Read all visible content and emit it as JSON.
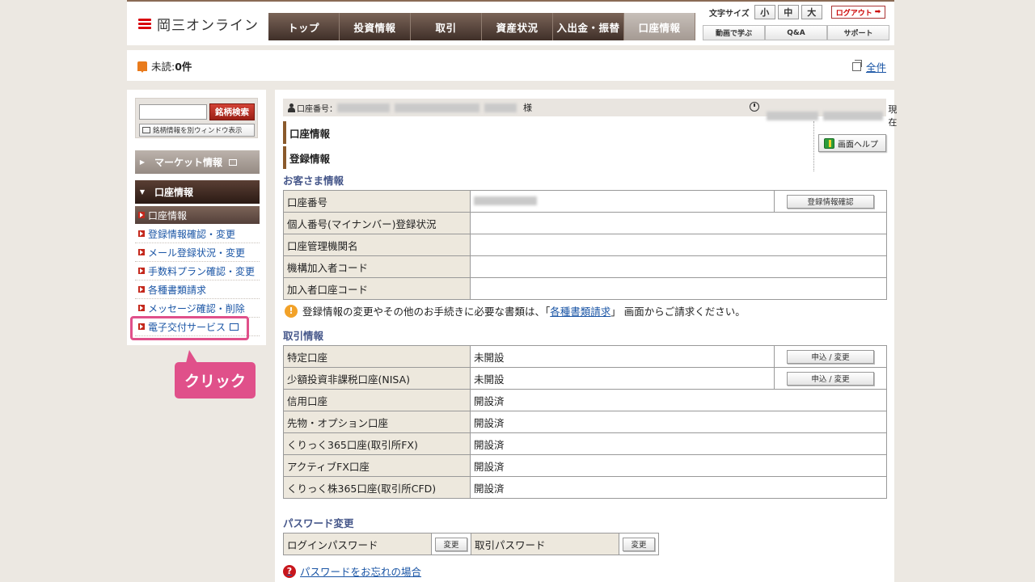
{
  "brand": {
    "name": "岡三オンライン",
    "accent": "#d9000d"
  },
  "global_nav": [
    {
      "label": "トップ",
      "active": false
    },
    {
      "label": "投資情報",
      "active": false
    },
    {
      "label": "取引",
      "active": false
    },
    {
      "label": "資産状況",
      "active": false
    },
    {
      "label": "入出金・振替",
      "active": false
    },
    {
      "label": "口座情報",
      "active": true
    }
  ],
  "font_size": {
    "label": "文字サイズ",
    "small": "小",
    "medium": "中",
    "large": "大"
  },
  "logout_label": "ログアウト",
  "sub_nav": [
    "動画で学ぶ",
    "Q&A",
    "サポート"
  ],
  "unread": {
    "label": "未読:",
    "count": "0件",
    "all_link": "全件"
  },
  "sidebar": {
    "search_placeholder": "",
    "search_button": "銘柄検索",
    "new_window_button": "銘柄情報を別ウィンドウ表示",
    "market_header": "マーケット情報",
    "account_header": "口座情報",
    "items": [
      {
        "label": "口座情報"
      },
      {
        "label": "登録情報確認・変更"
      },
      {
        "label": "メール登録状況・変更"
      },
      {
        "label": "手数料プラン確認・変更"
      },
      {
        "label": "各種書類請求"
      },
      {
        "label": "メッセージ確認・削除"
      },
      {
        "label": "電子交付サービス"
      }
    ]
  },
  "callout": {
    "text": "クリック",
    "color": "#e0508a"
  },
  "account_bar": {
    "label": "口座番号：",
    "honorific": "様",
    "time_suffix": "現在"
  },
  "page": {
    "title": "口座情報",
    "subtitle": "登録情報",
    "help_button": "画面ヘルプ"
  },
  "customer": {
    "section_title": "お客さま情報",
    "rows": [
      {
        "label": "口座番号",
        "value": "",
        "button": "登録情報確認"
      },
      {
        "label": "個人番号(マイナンバー)登録状況",
        "value": ""
      },
      {
        "label": "口座管理機関名",
        "value": ""
      },
      {
        "label": "機構加入者コード",
        "value": ""
      },
      {
        "label": "加入者口座コード",
        "value": ""
      }
    ]
  },
  "notice": {
    "before": "登録情報の変更やその他のお手続きに必要な書類は、「",
    "link": "各種書類請求",
    "after": "」 画面からご請求ください。"
  },
  "trading": {
    "section_title": "取引情報",
    "rows": [
      {
        "label": "特定口座",
        "status": "未開設",
        "button": "申込 / 変更"
      },
      {
        "label": "少額投資非課税口座(NISA)",
        "status": "未開設",
        "button": "申込 / 変更"
      },
      {
        "label": "信用口座",
        "status": "開設済"
      },
      {
        "label": "先物・オプション口座",
        "status": "開設済"
      },
      {
        "label": "くりっく365口座(取引所FX)",
        "status": "開設済"
      },
      {
        "label": "アクティブFX口座",
        "status": "開設済"
      },
      {
        "label": "くりっく株365口座(取引所CFD)",
        "status": "開設済"
      }
    ]
  },
  "password": {
    "section_title": "パスワード変更",
    "login_label": "ログインパスワード",
    "trade_label": "取引パスワード",
    "change_button": "変更",
    "forgot_link": "パスワードをお忘れの場合"
  }
}
